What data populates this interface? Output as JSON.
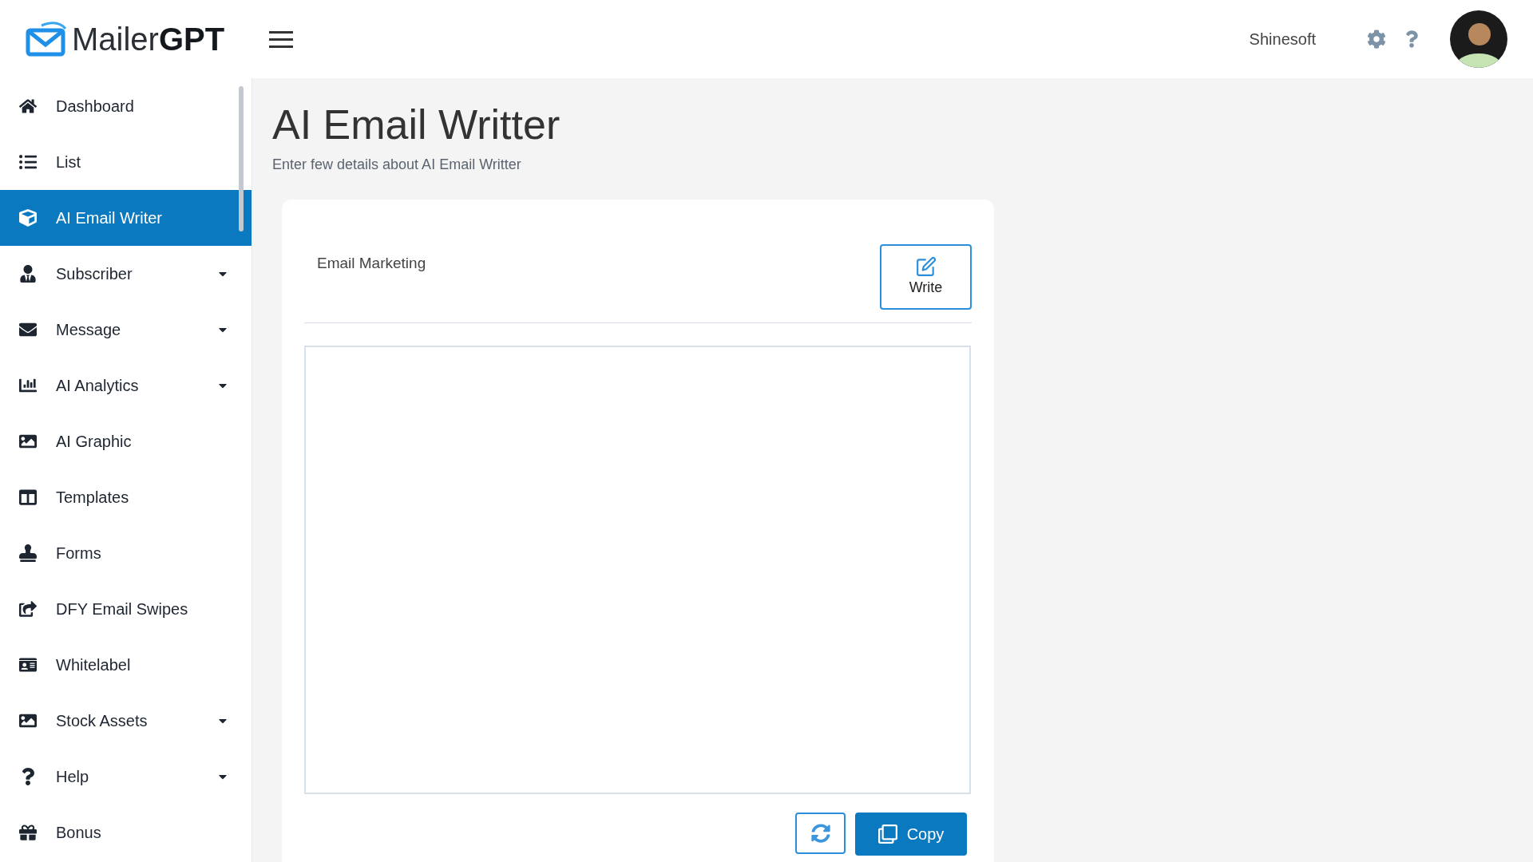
{
  "header": {
    "logo_light": "Mailer",
    "logo_bold": "GPT",
    "account": "Shinesoft"
  },
  "sidebar": {
    "items": [
      {
        "label": "Dashboard",
        "selected": false,
        "expandable": false
      },
      {
        "label": "List",
        "selected": false,
        "expandable": false
      },
      {
        "label": "AI Email Writer",
        "selected": true,
        "expandable": false
      },
      {
        "label": "Subscriber",
        "selected": false,
        "expandable": true
      },
      {
        "label": "Message",
        "selected": false,
        "expandable": true
      },
      {
        "label": "AI Analytics",
        "selected": false,
        "expandable": true
      },
      {
        "label": "AI Graphic",
        "selected": false,
        "expandable": false
      },
      {
        "label": "Templates",
        "selected": false,
        "expandable": false
      },
      {
        "label": "Forms",
        "selected": false,
        "expandable": false
      },
      {
        "label": "DFY Email Swipes",
        "selected": false,
        "expandable": false
      },
      {
        "label": "Whitelabel",
        "selected": false,
        "expandable": false
      },
      {
        "label": "Stock Assets",
        "selected": false,
        "expandable": true
      },
      {
        "label": "Help",
        "selected": false,
        "expandable": true
      },
      {
        "label": "Bonus",
        "selected": false,
        "expandable": false
      }
    ]
  },
  "page": {
    "title": "AI Email Writter",
    "subtitle": "Enter few details about AI Email Writter"
  },
  "writer": {
    "topic": {
      "value": "Email Marketing"
    },
    "write_button": "Write",
    "copy_button": "Copy"
  }
}
